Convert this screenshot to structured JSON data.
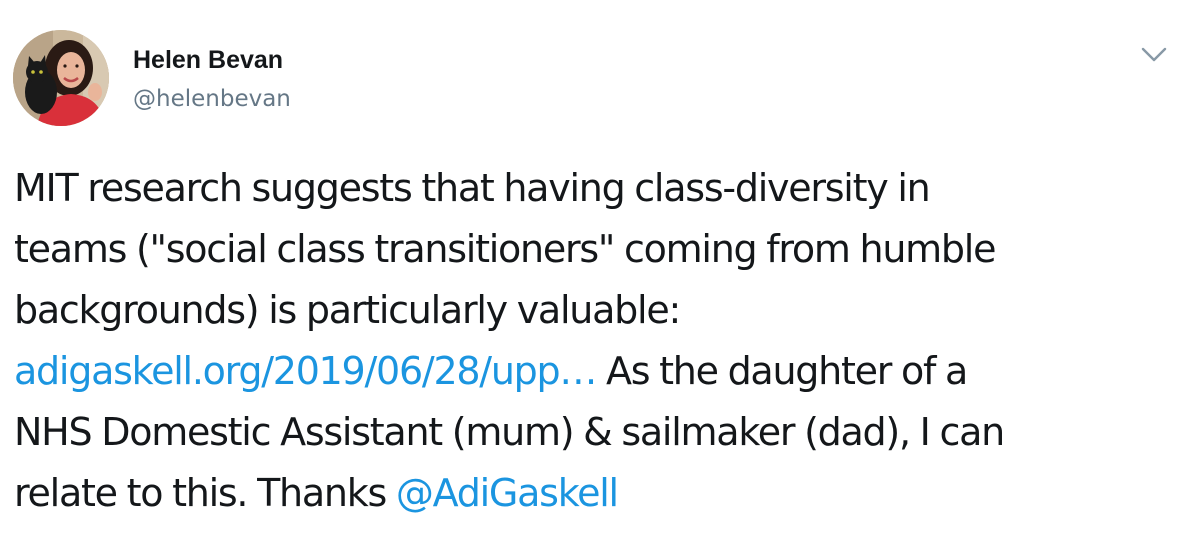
{
  "author": {
    "display_name": "Helen Bevan",
    "handle": "@helenbevan"
  },
  "icons": {
    "menu": "chevron-down-icon",
    "avatar": "profile-photo"
  },
  "colors": {
    "link": "#1b95e0",
    "text": "#14171a",
    "secondary": "#657786"
  },
  "tweet": {
    "line1": "MIT research suggests that having class-diversity in",
    "line2": "teams (\"social class transitioners\" coming from humble",
    "line3": "backgrounds) is particularly valuable:",
    "link_url_text": "adigaskell.org/2019/06/28/upp…",
    "line4_rest": " As the daughter of a",
    "line5": "NHS Domestic Assistant (mum) & sailmaker (dad), I can",
    "line6_start": "relate to this. Thanks ",
    "mention": "@AdiGaskell"
  }
}
